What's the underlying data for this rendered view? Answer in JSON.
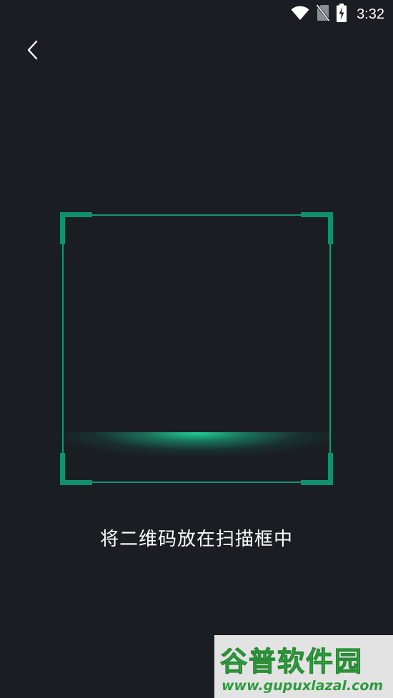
{
  "status_bar": {
    "time": "3:32",
    "icons": [
      "wifi-icon",
      "no-sim-icon",
      "battery-charging-icon"
    ]
  },
  "navigation": {
    "back_icon": "chevron-left-icon"
  },
  "scanner": {
    "hint": "将二维码放在扫描框中",
    "accent_color": "#11906e"
  },
  "watermark": {
    "logo_text": "谷普软件园",
    "url": "www.gupuxlazal.com"
  },
  "colors": {
    "background": "#1a1e23",
    "accent": "#11906e",
    "scan_glow": "#22dca0"
  }
}
